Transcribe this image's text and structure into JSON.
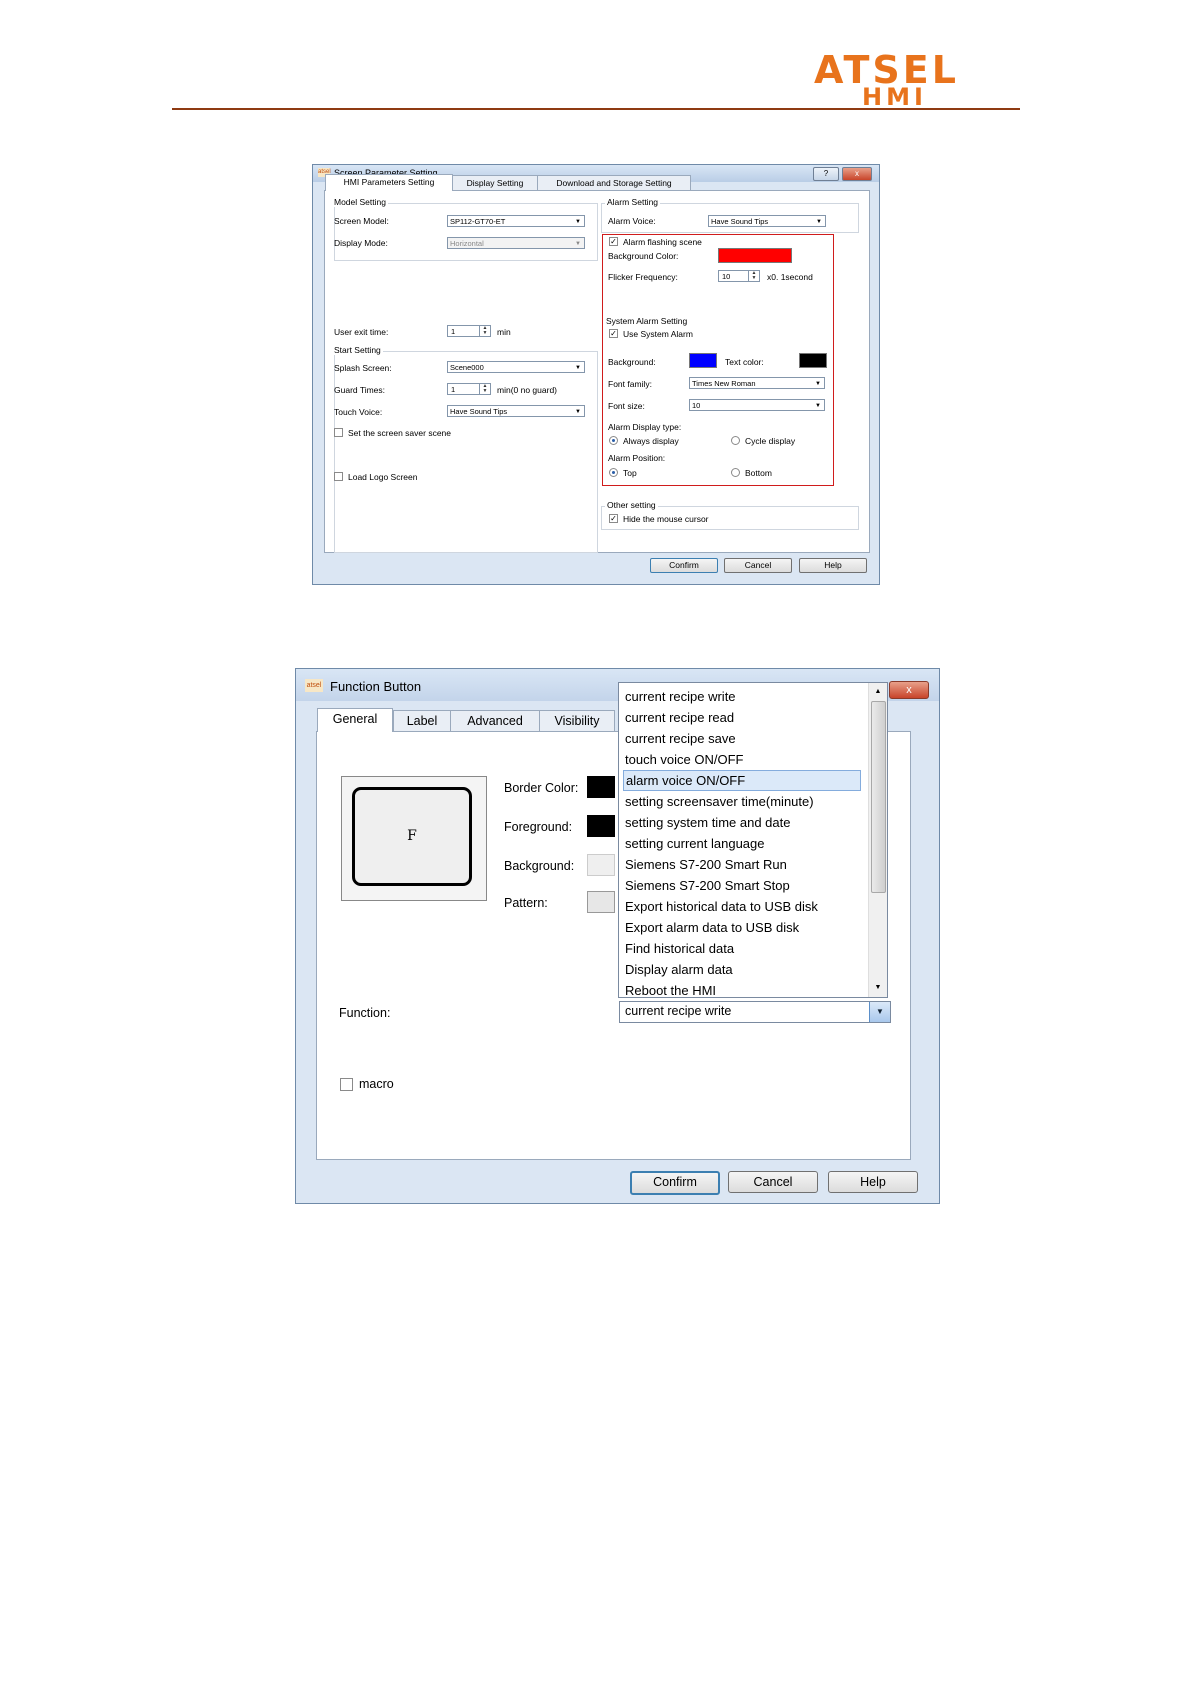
{
  "header": {
    "logo_line1": "ATSEL",
    "logo_line2": "HMI",
    "brand_color": "#e8731c"
  },
  "dialog1": {
    "title": "Screen Parameter Setting",
    "help_btn": "?",
    "close_btn": "x",
    "tabs": [
      "HMI Parameters Setting",
      "Display Setting",
      "Download and Storage Setting"
    ],
    "model_setting": {
      "group": "Model Setting",
      "screen_model_label": "Screen Model:",
      "screen_model_value": "SP112-GT70-ET",
      "display_mode_label": "Display Mode:",
      "display_mode_value": "Horizontal"
    },
    "user_exit": {
      "label": "User exit time:",
      "value": "1",
      "unit": "min"
    },
    "start_setting": {
      "group": "Start Setting",
      "splash_label": "Splash Screen:",
      "splash_value": "Scene000",
      "guard_label": "Guard Times:",
      "guard_value": "1",
      "guard_unit": "min(0 no guard)",
      "touch_label": "Touch Voice:",
      "touch_value": "Have Sound Tips",
      "screensaver_label": "Set the screen saver scene",
      "logo_label": "Load Logo Screen"
    },
    "alarm_setting": {
      "group": "Alarm Setting",
      "voice_label": "Alarm Voice:",
      "voice_value": "Have Sound Tips",
      "flash_label": "Alarm flashing scene",
      "bg_color_label": "Background Color:",
      "bg_color": "#ff0000",
      "flicker_label": "Flicker Frequency:",
      "flicker_value": "10",
      "flicker_unit": "x0. 1second"
    },
    "system_alarm": {
      "group": "System Alarm Setting",
      "use_label": "Use System Alarm",
      "bg_label": "Background:",
      "bg_color": "#0000ff",
      "text_color_label": "Text color:",
      "text_color": "#000000",
      "font_family_label": "Font family:",
      "font_family_value": "Times New Roman",
      "font_size_label": "Font size:",
      "font_size_value": "10",
      "display_type_label": "Alarm Display type:",
      "always_label": "Always display",
      "cycle_label": "Cycle display",
      "position_label": "Alarm Position:",
      "top_label": "Top",
      "bottom_label": "Bottom"
    },
    "other_setting": {
      "group": "Other setting",
      "hide_cursor_label": "Hide the mouse cursor"
    },
    "buttons": {
      "confirm": "Confirm",
      "cancel": "Cancel",
      "help": "Help"
    }
  },
  "dialog2": {
    "title": "Function Button",
    "close_btn": "x",
    "tabs": [
      "General",
      "Label",
      "Advanced",
      "Visibility"
    ],
    "preview_char": "F",
    "border_color_label": "Border Color:",
    "foreground_label": "Foreground:",
    "background_label": "Background:",
    "pattern_label": "Pattern:",
    "function_label": "Function:",
    "function_value": "current recipe write",
    "macro_label": "macro",
    "buttons": {
      "confirm": "Confirm",
      "cancel": "Cancel",
      "help": "Help"
    },
    "dropdown_items": [
      "current recipe write",
      "current recipe read",
      "current recipe save",
      "touch voice ON/OFF",
      "alarm voice ON/OFF",
      "setting screensaver time(minute)",
      "setting system time and date",
      "setting current language",
      "Siemens S7-200 Smart Run",
      "Siemens S7-200 Smart Stop",
      "Export historical data to USB disk",
      "Export alarm data to USB disk",
      "Find historical data",
      "Display alarm data",
      "Reboot the HMI"
    ],
    "selected_item": "alarm voice ON/OFF"
  }
}
